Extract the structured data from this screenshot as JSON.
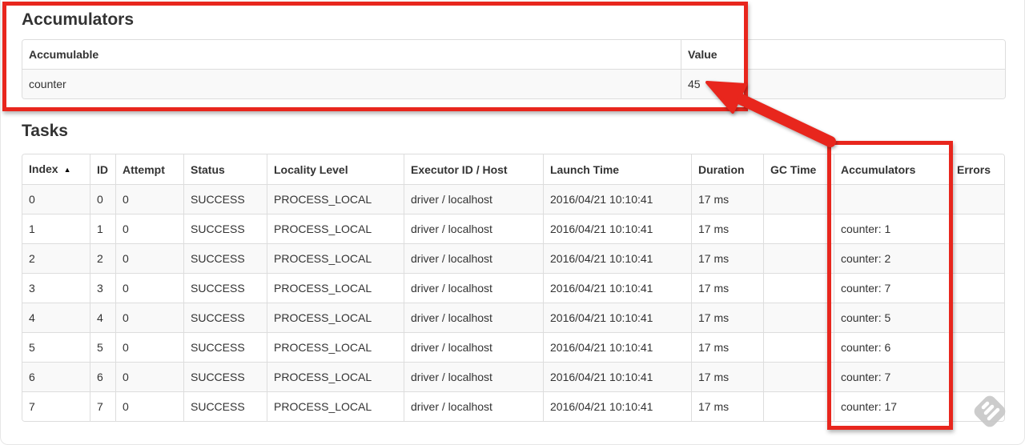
{
  "page": {
    "accumulators_section": {
      "title": "Accumulators",
      "table": {
        "headers": [
          "Accumulable",
          "Value"
        ],
        "rows": [
          [
            "counter",
            "45"
          ]
        ]
      }
    },
    "tasks_section": {
      "title": "Tasks",
      "table": {
        "headers": [
          "Index",
          "ID",
          "Attempt",
          "Status",
          "Locality Level",
          "Executor ID / Host",
          "Launch Time",
          "Duration",
          "GC Time",
          "Accumulators",
          "Errors"
        ],
        "sort": {
          "column": "Index",
          "direction_icon": "▲"
        },
        "rows": [
          [
            "0",
            "0",
            "0",
            "SUCCESS",
            "PROCESS_LOCAL",
            "driver / localhost",
            "2016/04/21 10:10:41",
            "17 ms",
            "",
            "",
            ""
          ],
          [
            "1",
            "1",
            "0",
            "SUCCESS",
            "PROCESS_LOCAL",
            "driver / localhost",
            "2016/04/21 10:10:41",
            "17 ms",
            "",
            "counter: 1",
            ""
          ],
          [
            "2",
            "2",
            "0",
            "SUCCESS",
            "PROCESS_LOCAL",
            "driver / localhost",
            "2016/04/21 10:10:41",
            "17 ms",
            "",
            "counter: 2",
            ""
          ],
          [
            "3",
            "3",
            "0",
            "SUCCESS",
            "PROCESS_LOCAL",
            "driver / localhost",
            "2016/04/21 10:10:41",
            "17 ms",
            "",
            "counter: 7",
            ""
          ],
          [
            "4",
            "4",
            "0",
            "SUCCESS",
            "PROCESS_LOCAL",
            "driver / localhost",
            "2016/04/21 10:10:41",
            "17 ms",
            "",
            "counter: 5",
            ""
          ],
          [
            "5",
            "5",
            "0",
            "SUCCESS",
            "PROCESS_LOCAL",
            "driver / localhost",
            "2016/04/21 10:10:41",
            "17 ms",
            "",
            "counter: 6",
            ""
          ],
          [
            "6",
            "6",
            "0",
            "SUCCESS",
            "PROCESS_LOCAL",
            "driver / localhost",
            "2016/04/21 10:10:41",
            "17 ms",
            "",
            "counter: 7",
            ""
          ],
          [
            "7",
            "7",
            "0",
            "SUCCESS",
            "PROCESS_LOCAL",
            "driver / localhost",
            "2016/04/21 10:10:41",
            "17 ms",
            "",
            "counter: 17",
            ""
          ]
        ]
      }
    },
    "annotations": {
      "color": "#e8261d",
      "highlighted_value": "45",
      "highlighted_column": "Accumulators"
    },
    "watermark_icon": "feedly-logo"
  }
}
